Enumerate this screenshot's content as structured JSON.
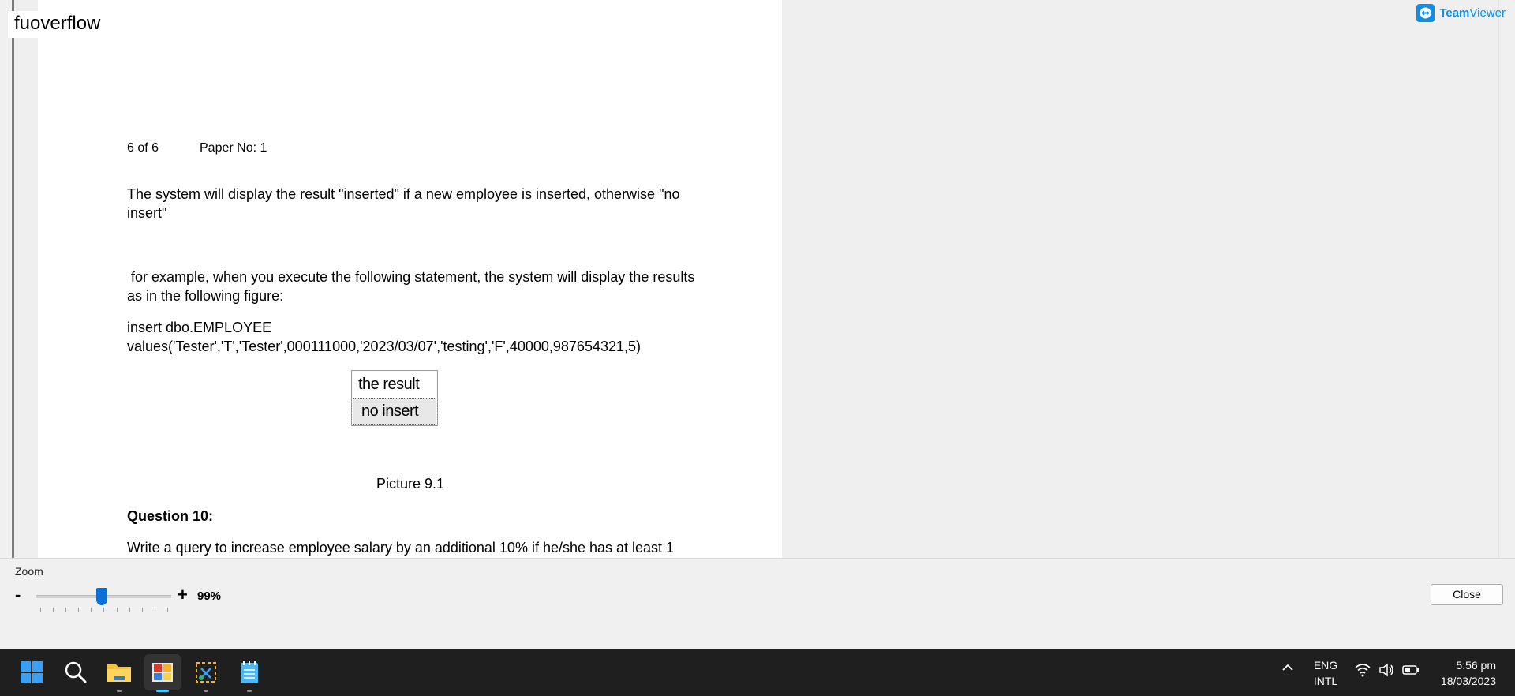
{
  "overlay_label": "fuoverflow",
  "teamviewer": {
    "name_bold": "Team",
    "name_rest": "Viewer"
  },
  "document": {
    "header_page": "6 of 6",
    "header_paper": "Paper No: 1",
    "para1_line1": "The system will display the result \"inserted\" if  a new employee is inserted, otherwise \"no",
    "para1_line2": "insert\"",
    "para2_line1": " for example, when you execute the following statement, the system will display the results",
    "para2_line2": "as in the following figure:",
    "code_line1": "insert dbo.EMPLOYEE",
    "code_line2": "values('Tester','T','Tester',000111000,'2023/03/07','testing','F',40000,987654321,5)",
    "result_header": "the result",
    "result_value": "no insert",
    "caption": "Picture 9.1",
    "question_title": "Question 10:",
    "question_line1": "Write a query to increase employee salary by an additional 10% if he/she has at least 1"
  },
  "zoom": {
    "title": "Zoom",
    "minus": "-",
    "plus": "+",
    "value_label": "99%",
    "value": 99
  },
  "buttons": {
    "close": "Close"
  },
  "taskbar": {
    "icons": [
      "windows-start-icon",
      "search-icon",
      "file-explorer-icon",
      "photo-viewer-icon",
      "snipping-tool-icon",
      "notepad-icon"
    ],
    "lang_top": "ENG",
    "lang_bottom": "INTL",
    "time": "5:56 pm",
    "date": "18/03/2023"
  },
  "colors": {
    "accent": "#0b6fd6",
    "teamviewer": "#0e8ee9",
    "taskbar": "#1f1f1f"
  }
}
